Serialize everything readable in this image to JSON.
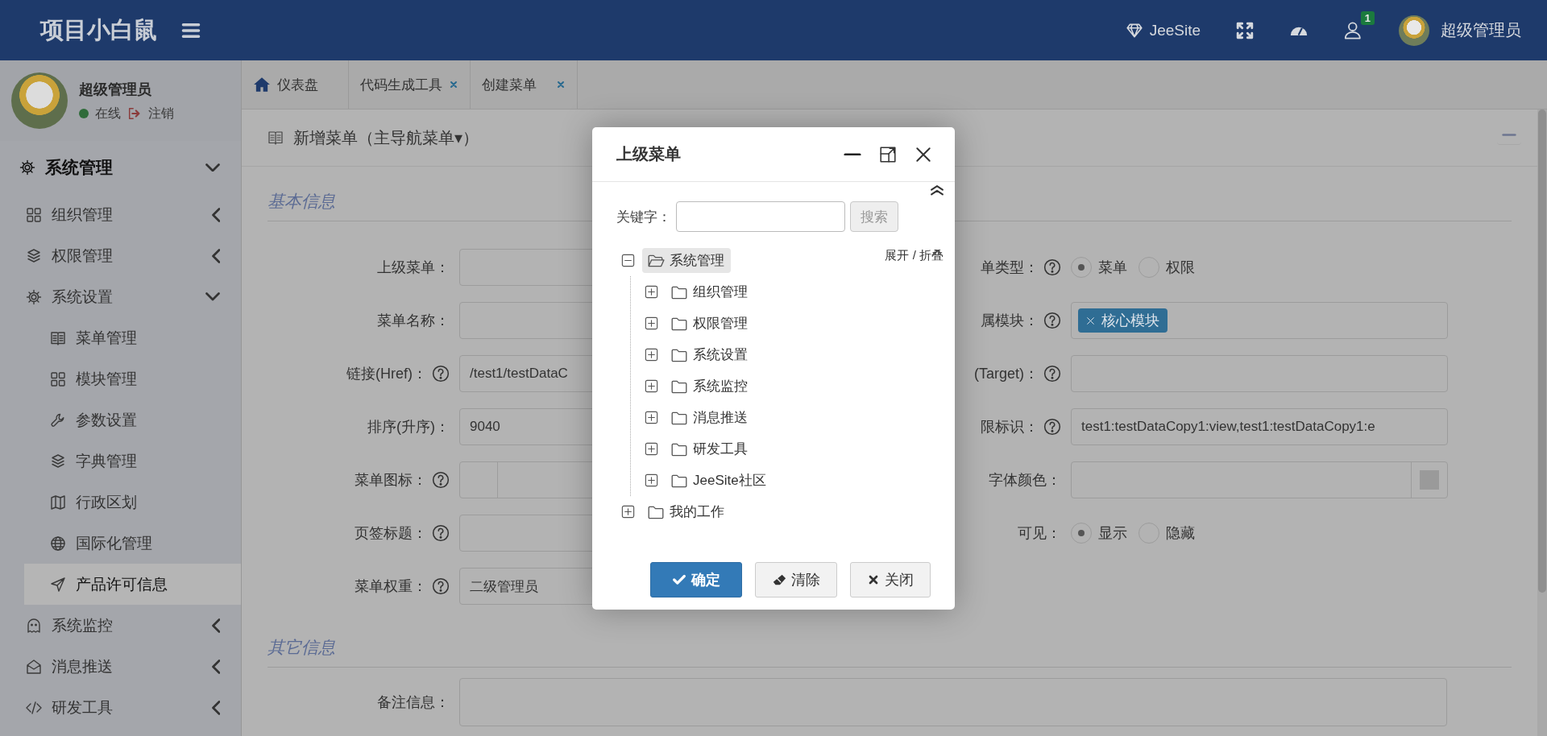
{
  "header": {
    "logo": "项目小白鼠",
    "brand_link": "JeeSite",
    "notification_count": "1",
    "user_name": "超级管理员"
  },
  "sidebar": {
    "user": {
      "name": "超级管理员",
      "status": "在线",
      "logout": "注销"
    },
    "menu": [
      {
        "label": "系统管理",
        "expanded": true,
        "children": [
          {
            "label": "组织管理",
            "expanded": false
          },
          {
            "label": "权限管理",
            "expanded": false
          },
          {
            "label": "系统设置",
            "expanded": true,
            "children": [
              {
                "label": "菜单管理",
                "selected": false
              },
              {
                "label": "模块管理",
                "selected": false
              },
              {
                "label": "参数设置",
                "selected": false
              },
              {
                "label": "字典管理",
                "selected": false
              },
              {
                "label": "行政区划",
                "selected": false
              },
              {
                "label": "国际化管理",
                "selected": false
              },
              {
                "label": "产品许可信息",
                "selected": true
              }
            ]
          },
          {
            "label": "系统监控",
            "expanded": false
          },
          {
            "label": "消息推送",
            "expanded": false
          },
          {
            "label": "研发工具",
            "expanded": false
          }
        ]
      }
    ]
  },
  "tabs": [
    {
      "label": "仪表盘",
      "closable": false
    },
    {
      "label": "代码生成工具",
      "closable": true
    },
    {
      "label": "创建菜单",
      "closable": true
    }
  ],
  "page_title": "新增菜单（主导航菜单▾）",
  "form": {
    "section": "基本信息",
    "left": [
      {
        "label": "上级菜单：",
        "help": false,
        "kind": "input"
      },
      {
        "label": "菜单名称：",
        "help": false,
        "kind": "input"
      },
      {
        "label": "链接(Href)：",
        "help": true,
        "kind": "input",
        "value": "/test1/testDataC"
      },
      {
        "label": "排序(升序)：",
        "help": false,
        "kind": "input",
        "value": "9040"
      },
      {
        "label": "菜单图标：",
        "help": true,
        "kind": "icon"
      },
      {
        "label": "页签标题：",
        "help": true,
        "kind": "input"
      },
      {
        "label": "菜单权重：",
        "help": true,
        "kind": "select",
        "value": "二级管理员"
      }
    ],
    "right": [
      {
        "label": "单类型：",
        "help": true,
        "kind": "radio",
        "options": [
          {
            "label": "菜单",
            "selected": true
          },
          {
            "label": "权限",
            "selected": false
          }
        ]
      },
      {
        "label": "属模块：",
        "help": true,
        "kind": "tags",
        "tags": [
          "核心模块"
        ]
      },
      {
        "label": "(Target)：",
        "help": true,
        "kind": "input"
      },
      {
        "label": "限标识：",
        "help": true,
        "kind": "input",
        "value": "test1:testDataCopy1:view,test1:testDataCopy1:e"
      },
      {
        "label": "字体颜色：",
        "help": false,
        "kind": "color"
      },
      {
        "label": "可见：",
        "help": false,
        "kind": "radio",
        "options": [
          {
            "label": "显示",
            "selected": true
          },
          {
            "label": "隐藏",
            "selected": false
          }
        ]
      }
    ],
    "other_section": "其它信息",
    "other": [
      {
        "label": "备注信息：",
        "help": false,
        "kind": "textarea"
      }
    ]
  },
  "dialog": {
    "title": "上级菜单",
    "keyword_label": "关键字：",
    "search_button": "搜索",
    "expand_collapse": "展开 / 折叠",
    "tree": [
      {
        "label": "系统管理",
        "expanded": true,
        "selected": true,
        "children": [
          {
            "label": "组织管理",
            "expanded": false,
            "selected": false
          },
          {
            "label": "权限管理",
            "expanded": false,
            "selected": false
          },
          {
            "label": "系统设置",
            "expanded": false,
            "selected": false
          },
          {
            "label": "系统监控",
            "expanded": false,
            "selected": false
          },
          {
            "label": "消息推送",
            "expanded": false,
            "selected": false
          },
          {
            "label": "研发工具",
            "expanded": false,
            "selected": false
          },
          {
            "label": "JeeSite社区",
            "expanded": false,
            "selected": false
          }
        ]
      },
      {
        "label": "我的工作",
        "expanded": false,
        "selected": false
      }
    ],
    "buttons": [
      {
        "label": "确定",
        "kind": "primary"
      },
      {
        "label": "清除",
        "kind": "clear"
      },
      {
        "label": "关闭",
        "kind": "close"
      }
    ]
  }
}
